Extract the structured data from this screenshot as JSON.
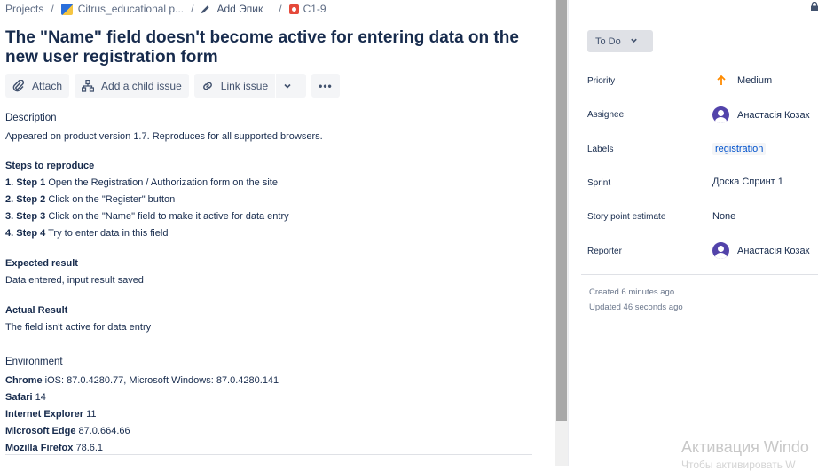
{
  "breadcrumbs": {
    "projects": "Projects",
    "project": "Citrus_educational p...",
    "epic": "Add Эпик",
    "issue_key": "C1-9"
  },
  "issue": {
    "title": "The \"Name\" field doesn't become active for entering data on the new user registration form"
  },
  "toolbar": {
    "attach": "Attach",
    "add_child": "Add a child issue",
    "link_issue": "Link issue",
    "more": "•••"
  },
  "description": {
    "heading": "Description",
    "intro": "Appeared on product version 1.7. Reproduces for all supported browsers.",
    "steps_heading": "Steps to reproduce",
    "steps": [
      {
        "num": "1. Step 1",
        "text": "Open the Registration / Authorization form on the site"
      },
      {
        "num": "2. Step 2",
        "text": "Click on the \"Register\" button"
      },
      {
        "num": "3. Step 3",
        "text": "Click on the \"Name\" field to make it active for data entry"
      },
      {
        "num": "4. Step 4",
        "text": "Try to enter data in this field"
      }
    ],
    "expected_heading": "Expected result",
    "expected_text": "Data entered, input result saved",
    "actual_heading": "Actual Result",
    "actual_text": "The field isn't active for data entry",
    "env_heading": "Environment",
    "environment": [
      {
        "name": "Chrome",
        "value": "iOS: 87.0.4280.77, Microsoft Windows: 87.0.4280.141"
      },
      {
        "name": "Safari",
        "value": "14"
      },
      {
        "name": "Internet Explorer",
        "value": "11"
      },
      {
        "name": "Microsoft Edge",
        "value": "87.0.664.66"
      },
      {
        "name": "Mozilla Firefox",
        "value": "78.6.1"
      }
    ]
  },
  "sidebar": {
    "status": "To Do",
    "fields": {
      "priority_label": "Priority",
      "priority_value": "Medium",
      "assignee_label": "Assignee",
      "assignee_value": "Анастасія Козак",
      "labels_label": "Labels",
      "labels_value": "registration",
      "sprint_label": "Sprint",
      "sprint_value": "Доска Спринт 1",
      "story_points_label": "Story point estimate",
      "story_points_value": "None",
      "reporter_label": "Reporter",
      "reporter_value": "Анастасія Козак"
    },
    "created": "Created 6 minutes ago",
    "updated": "Updated 46 seconds ago"
  },
  "watermark": {
    "line1": "Активация Windo",
    "line2": "Чтобы активировать W"
  },
  "colors": {
    "priority_arrow": "#ff8b00",
    "avatar": "#5243aa",
    "label_text": "#0052cc",
    "bug_icon": "#e5493a"
  }
}
